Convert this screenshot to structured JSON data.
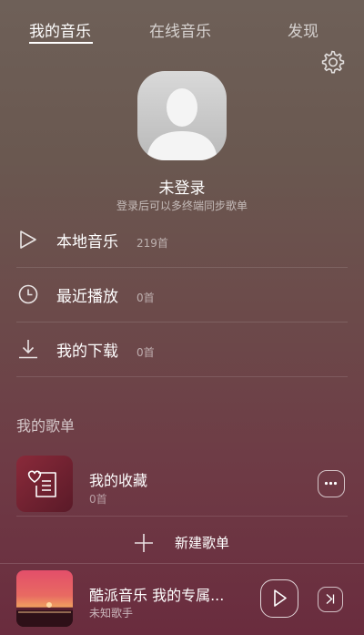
{
  "tabs": [
    {
      "label": "我的音乐",
      "active": true
    },
    {
      "label": "在线音乐",
      "active": false
    },
    {
      "label": "发现",
      "active": false
    }
  ],
  "user": {
    "name": "未登录",
    "hint": "登录后可以多终端同步歌单"
  },
  "menu": [
    {
      "label": "本地音乐",
      "count": "219首",
      "icon": "play-icon"
    },
    {
      "label": "最近播放",
      "count": "0首",
      "icon": "clock-icon"
    },
    {
      "label": "我的下载",
      "count": "0首",
      "icon": "download-icon"
    }
  ],
  "playlists": {
    "section_title": "我的歌单",
    "items": [
      {
        "name": "我的收藏",
        "count": "0首",
        "icon": "favorite-list-icon"
      }
    ],
    "new_label": "新建歌单"
  },
  "now_playing": {
    "title": "酷派音乐 我的专属...",
    "artist": "未知歌手"
  },
  "icons": {
    "settings": "gear-icon",
    "more": "more-icon",
    "play": "play-icon",
    "next": "skip-next-icon",
    "add": "plus-icon"
  }
}
